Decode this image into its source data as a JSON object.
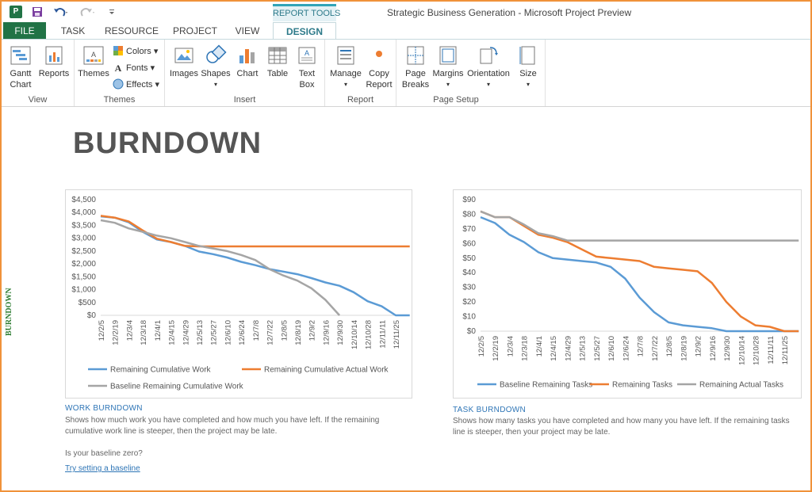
{
  "titlebar": {
    "app_icon_text": "P",
    "window_title": "Strategic Business Generation - Microsoft Project Preview",
    "context_tab": "REPORT TOOLS",
    "qat_icons": [
      "save-icon",
      "undo-icon",
      "redo-icon",
      "customize-icon"
    ]
  },
  "tabs": [
    {
      "label": "FILE"
    },
    {
      "label": "TASK"
    },
    {
      "label": "RESOURCE"
    },
    {
      "label": "PROJECT"
    },
    {
      "label": "VIEW"
    },
    {
      "label": "DESIGN"
    }
  ],
  "ribbon": {
    "groups": {
      "view": "View",
      "themes": "Themes",
      "insert": "Insert",
      "report": "Report",
      "page_setup": "Page Setup"
    },
    "buttons": {
      "gantt_chart": "Gantt\nChart",
      "reports": "Reports",
      "themes": "Themes",
      "colors": "Colors",
      "fonts": "Fonts",
      "effects": "Effects",
      "images": "Images",
      "shapes": "Shapes",
      "chart": "Chart",
      "table": "Table",
      "text_box": "Text\nBox",
      "manage": "Manage",
      "copy_report": "Copy\nReport",
      "page_breaks": "Page\nBreaks",
      "margins": "Margins",
      "orientation": "Orientation",
      "size": "Size"
    }
  },
  "sidebar_label": "BURNDOWN",
  "report_title": "BURNDOWN",
  "x_categories": [
    "12/2/5",
    "12/2/19",
    "12/3/4",
    "12/3/18",
    "12/4/1",
    "12/4/15",
    "12/4/29",
    "12/5/13",
    "12/5/27",
    "12/6/10",
    "12/6/24",
    "12/7/8",
    "12/7/22",
    "12/8/5",
    "12/8/19",
    "12/9/2",
    "12/9/16",
    "12/9/30",
    "12/10/14",
    "12/10/28",
    "12/11/11",
    "12/11/25"
  ],
  "chart_data": [
    {
      "type": "line",
      "title": "",
      "ylim": [
        0,
        4500
      ],
      "y_ticks": [
        "$0",
        "$500",
        "$1,000",
        "$1,500",
        "$2,000",
        "$2,500",
        "$3,000",
        "$3,500",
        "$4,000",
        "$4,500"
      ],
      "legend_position": "bottom",
      "x_labels": [
        "12/2/5",
        "12/2/19",
        "12/3/4",
        "12/3/18",
        "12/4/1",
        "12/4/15",
        "12/4/29",
        "12/5/13",
        "12/5/27",
        "12/6/10",
        "12/6/24",
        "12/7/8",
        "12/7/22",
        "12/8/5",
        "12/8/19",
        "12/9/2",
        "12/9/16",
        "12/9/30",
        "12/10/14",
        "12/10/28",
        "12/11/11",
        "12/11/25"
      ],
      "series": [
        {
          "name": "Remaining Cumulative Work",
          "color": "#5b9bd5",
          "points": [
            [
              0,
              3850
            ],
            [
              1,
              3800
            ],
            [
              2,
              3620
            ],
            [
              3,
              3250
            ],
            [
              4,
              2950
            ],
            [
              5,
              2850
            ],
            [
              6,
              2700
            ],
            [
              7,
              2480
            ],
            [
              8,
              2380
            ],
            [
              9,
              2250
            ],
            [
              10,
              2080
            ],
            [
              11,
              1950
            ],
            [
              12,
              1800
            ],
            [
              13,
              1700
            ],
            [
              14,
              1600
            ],
            [
              15,
              1450
            ],
            [
              16,
              1280
            ],
            [
              17,
              1150
            ],
            [
              18,
              900
            ],
            [
              19,
              550
            ],
            [
              20,
              350
            ],
            [
              21,
              0
            ],
            [
              22,
              0
            ]
          ]
        },
        {
          "name": "Remaining Cumulative Actual Work",
          "color": "#ed7d31",
          "points": [
            [
              0,
              3870
            ],
            [
              1,
              3800
            ],
            [
              2,
              3650
            ],
            [
              3,
              3300
            ],
            [
              4,
              2980
            ],
            [
              5,
              2850
            ],
            [
              6,
              2700
            ],
            [
              7,
              2680
            ],
            [
              8,
              2680
            ],
            [
              9,
              2680
            ],
            [
              10,
              2680
            ],
            [
              11,
              2680
            ],
            [
              12,
              2680
            ],
            [
              13,
              2680
            ],
            [
              14,
              2680
            ],
            [
              15,
              2680
            ],
            [
              16,
              2680
            ],
            [
              17,
              2680
            ],
            [
              18,
              2680
            ],
            [
              19,
              2680
            ],
            [
              20,
              2680
            ],
            [
              21,
              2680
            ],
            [
              22,
              2680
            ]
          ]
        },
        {
          "name": "Baseline Remaining Cumulative Work",
          "color": "#a5a5a5",
          "points": [
            [
              0,
              3700
            ],
            [
              1,
              3600
            ],
            [
              2,
              3380
            ],
            [
              3,
              3250
            ],
            [
              4,
              3100
            ],
            [
              5,
              3000
            ],
            [
              6,
              2850
            ],
            [
              7,
              2700
            ],
            [
              8,
              2600
            ],
            [
              9,
              2500
            ],
            [
              10,
              2350
            ],
            [
              11,
              2150
            ],
            [
              12,
              1800
            ],
            [
              13,
              1550
            ],
            [
              14,
              1350
            ],
            [
              15,
              1050
            ],
            [
              16,
              600
            ],
            [
              17,
              0
            ]
          ]
        }
      ]
    },
    {
      "type": "line",
      "title": "",
      "ylim": [
        0,
        90
      ],
      "y_ticks": [
        "$0",
        "$10",
        "$20",
        "$30",
        "$40",
        "$50",
        "$60",
        "$70",
        "$80",
        "$90"
      ],
      "legend_position": "bottom",
      "x_labels": [
        "12/2/5",
        "12/2/19",
        "12/3/4",
        "12/3/18",
        "12/4/1",
        "12/4/15",
        "12/4/29",
        "12/5/13",
        "12/5/27",
        "12/6/10",
        "12/6/24",
        "12/7/8",
        "12/7/22",
        "12/8/5",
        "12/8/19",
        "12/9/2",
        "12/9/16",
        "12/9/30",
        "12/10/14",
        "12/10/28",
        "12/11/11",
        "12/11/25"
      ],
      "series": [
        {
          "name": "Baseline Remaining Tasks",
          "color": "#5b9bd5",
          "points": [
            [
              0,
              78
            ],
            [
              1,
              74
            ],
            [
              2,
              66
            ],
            [
              3,
              61
            ],
            [
              4,
              54
            ],
            [
              5,
              50
            ],
            [
              6,
              49
            ],
            [
              7,
              48
            ],
            [
              8,
              47
            ],
            [
              9,
              44
            ],
            [
              10,
              36
            ],
            [
              11,
              23
            ],
            [
              12,
              13
            ],
            [
              13,
              6
            ],
            [
              14,
              4
            ],
            [
              15,
              3
            ],
            [
              16,
              2
            ],
            [
              17,
              0
            ],
            [
              18,
              0
            ],
            [
              19,
              0
            ],
            [
              20,
              0
            ],
            [
              21,
              0
            ],
            [
              22,
              0
            ]
          ]
        },
        {
          "name": "Remaining Tasks",
          "color": "#ed7d31",
          "points": [
            [
              0,
              82
            ],
            [
              1,
              78
            ],
            [
              2,
              78
            ],
            [
              3,
              72
            ],
            [
              4,
              66
            ],
            [
              5,
              64
            ],
            [
              6,
              61
            ],
            [
              7,
              56
            ],
            [
              8,
              51
            ],
            [
              9,
              50
            ],
            [
              10,
              49
            ],
            [
              11,
              48
            ],
            [
              12,
              44
            ],
            [
              13,
              43
            ],
            [
              14,
              42
            ],
            [
              15,
              41
            ],
            [
              16,
              33
            ],
            [
              17,
              20
            ],
            [
              18,
              10
            ],
            [
              19,
              4
            ],
            [
              20,
              3
            ],
            [
              21,
              0
            ],
            [
              22,
              0
            ]
          ]
        },
        {
          "name": "Remaining Actual Tasks",
          "color": "#a5a5a5",
          "points": [
            [
              0,
              82
            ],
            [
              1,
              78
            ],
            [
              2,
              78
            ],
            [
              3,
              73
            ],
            [
              4,
              67
            ],
            [
              5,
              65
            ],
            [
              6,
              62
            ],
            [
              7,
              62
            ],
            [
              8,
              62
            ],
            [
              9,
              62
            ],
            [
              10,
              62
            ],
            [
              11,
              62
            ],
            [
              12,
              62
            ],
            [
              13,
              62
            ],
            [
              14,
              62
            ],
            [
              15,
              62
            ],
            [
              16,
              62
            ],
            [
              17,
              62
            ],
            [
              18,
              62
            ],
            [
              19,
              62
            ],
            [
              20,
              62
            ],
            [
              21,
              62
            ],
            [
              22,
              62
            ]
          ]
        }
      ]
    }
  ],
  "work_burndown": {
    "title": "WORK BURNDOWN",
    "text": "Shows how much work you have completed and how much you have left. If the remaining cumulative work line is steeper, then the project may be late.",
    "question": "Is your baseline zero?",
    "link": "Try setting a baseline"
  },
  "task_burndown": {
    "title": "TASK BURNDOWN",
    "text": "Shows how many tasks you have completed and how many you have left. If the remaining tasks line is steeper, then your project may be late."
  }
}
